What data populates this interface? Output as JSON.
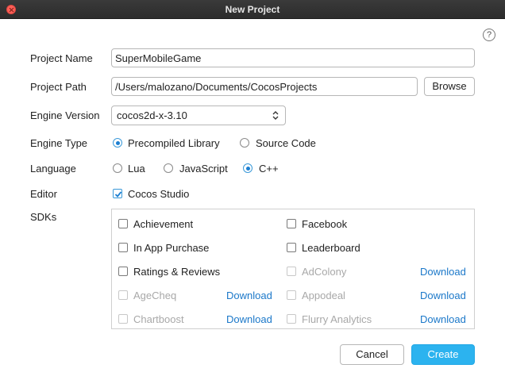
{
  "window": {
    "title": "New Project"
  },
  "help": {
    "icon": "help-icon",
    "glyph": "?"
  },
  "form": {
    "project_name": {
      "label": "Project Name",
      "value": "SuperMobileGame"
    },
    "project_path": {
      "label": "Project Path",
      "value": "/Users/malozano/Documents/CocosProjects",
      "browse_label": "Browse"
    },
    "engine_version": {
      "label": "Engine Version",
      "selected": "cocos2d-x-3.10"
    },
    "engine_type": {
      "label": "Engine Type",
      "options": [
        "Precompiled Library",
        "Source Code"
      ],
      "selected": "Precompiled Library"
    },
    "language": {
      "label": "Language",
      "options": [
        "Lua",
        "JavaScript",
        "C++"
      ],
      "selected": "C++"
    },
    "editor": {
      "label": "Editor",
      "option": "Cocos Studio",
      "checked": true
    },
    "sdks": {
      "label": "SDKs",
      "download_label": "Download",
      "items": [
        {
          "name": "Achievement",
          "enabled": true,
          "checked": false,
          "download": false
        },
        {
          "name": "Facebook",
          "enabled": true,
          "checked": false,
          "download": false
        },
        {
          "name": "In App Purchase",
          "enabled": true,
          "checked": false,
          "download": false
        },
        {
          "name": "Leaderboard",
          "enabled": true,
          "checked": false,
          "download": false
        },
        {
          "name": "Ratings & Reviews",
          "enabled": true,
          "checked": false,
          "download": false
        },
        {
          "name": "AdColony",
          "enabled": false,
          "checked": false,
          "download": true
        },
        {
          "name": "AgeCheq",
          "enabled": false,
          "checked": false,
          "download": true
        },
        {
          "name": "Appodeal",
          "enabled": false,
          "checked": false,
          "download": true
        },
        {
          "name": "Chartboost",
          "enabled": false,
          "checked": false,
          "download": true
        },
        {
          "name": "Flurry Analytics",
          "enabled": false,
          "checked": false,
          "download": true
        }
      ]
    }
  },
  "actions": {
    "cancel_label": "Cancel",
    "create_label": "Create"
  },
  "colors": {
    "accent": "#2cb3ef",
    "link": "#1b78c9",
    "titlebar": "#2f2f2f"
  }
}
